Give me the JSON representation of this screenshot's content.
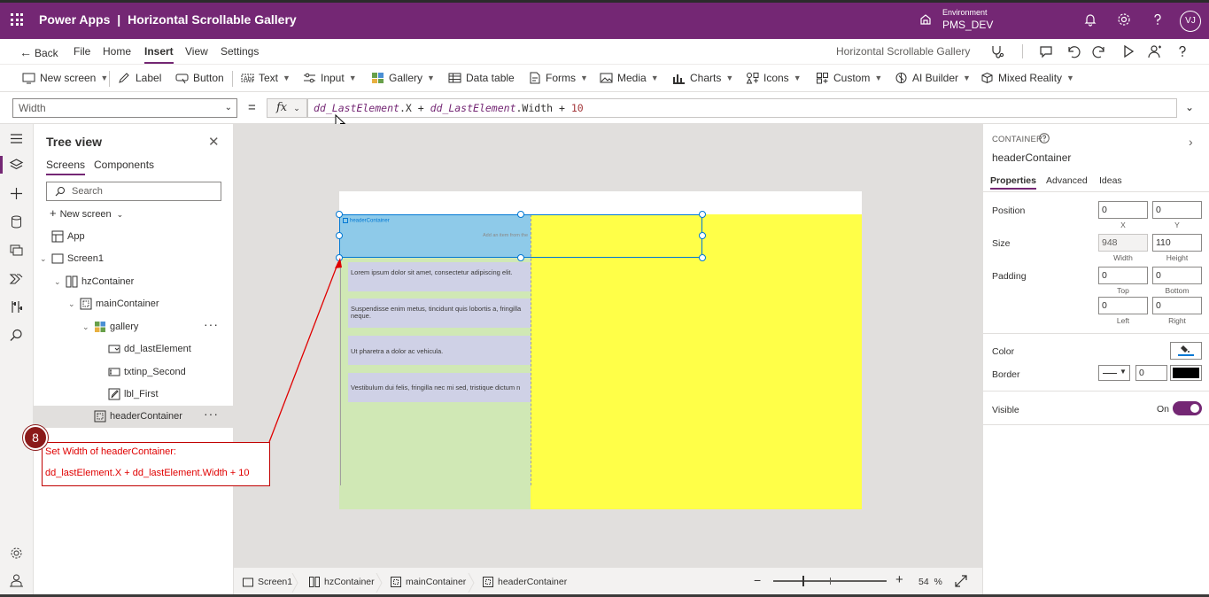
{
  "titlebar": {
    "app_name": "Power Apps",
    "separator": "|",
    "app_title": "Horizontal Scrollable Gallery",
    "environment_label": "Environment",
    "environment_value": "PMS_DEV",
    "avatar_initials": "VJ",
    "accent_color": "#742774"
  },
  "menubar": {
    "back": "Back",
    "items": [
      "File",
      "Home",
      "Insert",
      "View",
      "Settings"
    ],
    "active": "Insert",
    "screen_name": "Horizontal Scrollable Gallery"
  },
  "toolbar": {
    "items": [
      {
        "label": "New screen",
        "icon": "new-screen-icon"
      },
      {
        "label": "Label",
        "icon": "label-icon"
      },
      {
        "label": "Button",
        "icon": "button-icon"
      },
      {
        "label": "Text",
        "icon": "text-icon"
      },
      {
        "label": "Input",
        "icon": "input-icon"
      },
      {
        "label": "Gallery",
        "icon": "gallery-icon"
      },
      {
        "label": "Data table",
        "icon": "data-table-icon"
      },
      {
        "label": "Forms",
        "icon": "forms-icon"
      },
      {
        "label": "Media",
        "icon": "media-icon"
      },
      {
        "label": "Charts",
        "icon": "charts-icon"
      },
      {
        "label": "Icons",
        "icon": "icons-icon"
      },
      {
        "label": "Custom",
        "icon": "custom-icon"
      },
      {
        "label": "AI Builder",
        "icon": "ai-builder-icon"
      },
      {
        "label": "Mixed Reality",
        "icon": "mixed-reality-icon"
      }
    ]
  },
  "formulabar": {
    "property": "Width",
    "equals": "=",
    "fx": "fx",
    "formula_ref1": "dd_LastElement",
    "formula_mid1": ".X + ",
    "formula_ref2": "dd_LastElement",
    "formula_mid2": ".Width + ",
    "formula_num": "10"
  },
  "treeview": {
    "title": "Tree view",
    "tabs": [
      "Screens",
      "Components"
    ],
    "active_tab": "Screens",
    "search_placeholder": "Search",
    "new_screen": "New screen",
    "rows": [
      {
        "label": "App",
        "icon": "app-icon"
      },
      {
        "label": "Screen1",
        "icon": "screen-icon"
      },
      {
        "label": "hzContainer",
        "icon": "horizontal-container-icon"
      },
      {
        "label": "mainContainer",
        "icon": "container-icon"
      },
      {
        "label": "gallery",
        "icon": "gallery-icon"
      },
      {
        "label": "dd_lastElement",
        "icon": "dropdown-icon"
      },
      {
        "label": "txtinp_Second",
        "icon": "text-input-icon"
      },
      {
        "label": "lbl_First",
        "icon": "label-icon"
      },
      {
        "label": "headerContainer",
        "icon": "container-icon"
      }
    ],
    "selected": "headerContainer"
  },
  "canvas": {
    "header_container_label": "headerContainer",
    "header_hint": "Add an item from the",
    "gallery_items": [
      "Lorem ipsum dolor sit amet, consectetur adipiscing elit.",
      "Suspendisse enim metus, tincidunt quis lobortis a, fringilla neque.",
      "Ut pharetra a dolor ac vehicula.",
      "Vestibulum dui felis, fringilla nec mi sed, tristique dictum n"
    ]
  },
  "annotation": {
    "step": "8",
    "line1": "Set Width of headerContainer:",
    "line2": "dd_lastElement.X + dd_lastElement.Width + 10",
    "color": "#e00000"
  },
  "statusbar": {
    "breadcrumbs": [
      "Screen1",
      "hzContainer",
      "mainContainer",
      "headerContainer"
    ],
    "zoom_minus": "−",
    "zoom_plus": "+",
    "zoom_value": "54  %"
  },
  "properties": {
    "type": "CONTAINER",
    "name": "headerContainer",
    "tabs": [
      "Properties",
      "Advanced",
      "Ideas"
    ],
    "active_tab": "Properties",
    "position_label": "Position",
    "position_x": "0",
    "position_y": "0",
    "x_label": "X",
    "y_label": "Y",
    "size_label": "Size",
    "width": "948",
    "height": "110",
    "width_label": "Width",
    "height_label": "Height",
    "padding_label": "Padding",
    "padding_top": "0",
    "padding_bottom": "0",
    "padding_left": "0",
    "padding_right": "0",
    "top_label": "Top",
    "bottom_label": "Bottom",
    "left_label": "Left",
    "right_label": "Right",
    "color_label": "Color",
    "border_label": "Border",
    "border_width": "0",
    "visible_label": "Visible",
    "visible_state": "On"
  }
}
